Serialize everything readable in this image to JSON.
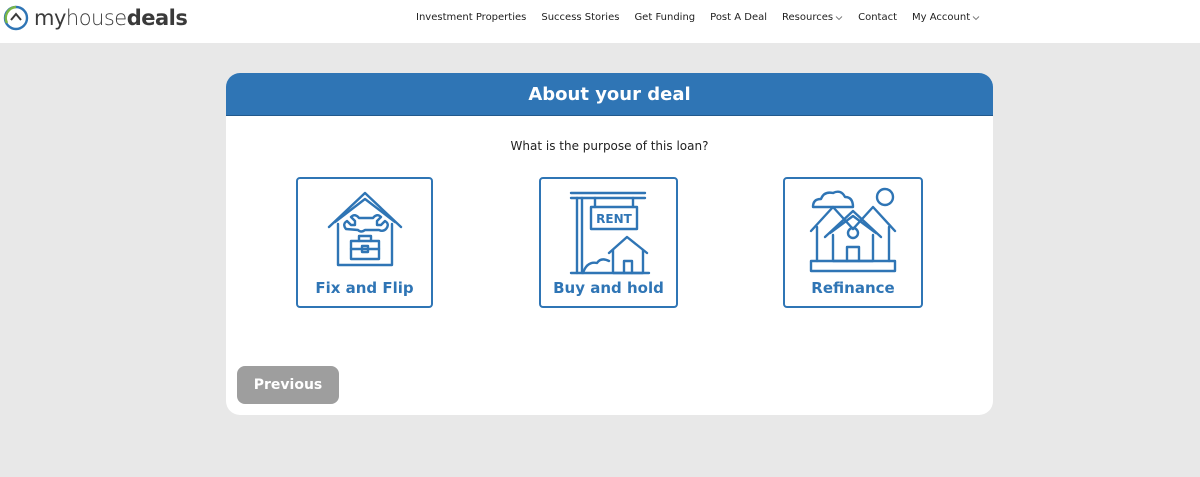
{
  "brand": {
    "part1": "my",
    "part2": "house",
    "part3": "deals",
    "accent": "#2f75b5",
    "logo_green": "#7ab648"
  },
  "nav": {
    "items": [
      {
        "label": "Investment Properties",
        "dropdown": false
      },
      {
        "label": "Success Stories",
        "dropdown": false
      },
      {
        "label": "Get Funding",
        "dropdown": false
      },
      {
        "label": "Post A Deal",
        "dropdown": false
      },
      {
        "label": "Resources",
        "dropdown": true
      },
      {
        "label": "Contact",
        "dropdown": false
      },
      {
        "label": "My Account",
        "dropdown": true
      }
    ]
  },
  "card": {
    "title": "About your deal",
    "question": "What is the purpose of this loan?",
    "options": [
      {
        "label": "Fix and Flip",
        "icon": "house-toolbox-icon"
      },
      {
        "label": "Buy and hold",
        "icon": "rent-sign-house-icon"
      },
      {
        "label": "Refinance",
        "icon": "houses-sun-cloud-icon"
      }
    ],
    "previous_label": "Previous"
  },
  "colors": {
    "header_bg": "#2f75b5",
    "button_gray": "#9e9e9e",
    "page_bg": "#e8e8e8"
  }
}
